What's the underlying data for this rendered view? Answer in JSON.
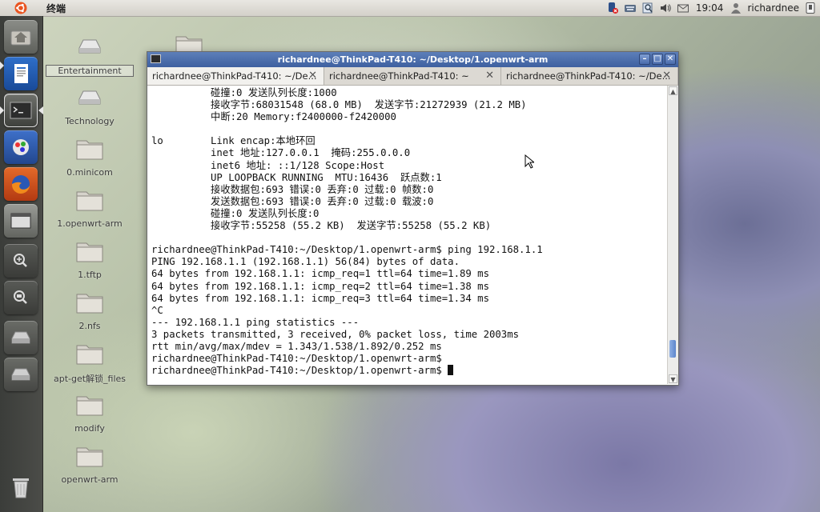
{
  "top_panel": {
    "app_title": "终端",
    "clock": "19:04",
    "username": "richardnee",
    "tray_icons": [
      "network-error-icon",
      "keyboard-icon",
      "search-icon",
      "volume-icon",
      "mail-icon"
    ]
  },
  "launcher": {
    "items": [
      {
        "name": "home-folder-icon"
      },
      {
        "name": "document-icon"
      },
      {
        "name": "terminal-icon"
      },
      {
        "name": "tweak-tool-icon"
      },
      {
        "name": "firefox-icon"
      },
      {
        "name": "window-icon"
      },
      {
        "name": "zoom-in-icon"
      },
      {
        "name": "zoom-icon"
      },
      {
        "name": "drive-icon"
      },
      {
        "name": "drive-icon"
      },
      {
        "name": "trash-icon"
      }
    ]
  },
  "desktop_icons": [
    {
      "label": "Entertainment",
      "type": "drive"
    },
    {
      "label": "Technology",
      "type": "drive"
    },
    {
      "label": "0.minicom",
      "type": "folder"
    },
    {
      "label": "1.openwrt-arm",
      "type": "folder"
    },
    {
      "label": "1.tftp",
      "type": "folder"
    },
    {
      "label": "2.nfs",
      "type": "folder"
    },
    {
      "label": "apt-get解锁_files",
      "type": "folder"
    },
    {
      "label": "modify",
      "type": "folder"
    },
    {
      "label": "openwrt-arm",
      "type": "folder"
    }
  ],
  "terminal": {
    "window_title": "richardnee@ThinkPad-T410: ~/Desktop/1.openwrt-arm",
    "tabs": [
      {
        "label": "richardnee@ThinkPad-T410: ~/De..."
      },
      {
        "label": "richardnee@ThinkPad-T410: ~"
      },
      {
        "label": "richardnee@ThinkPad-T410: ~/De..."
      }
    ],
    "lines": [
      "          碰撞:0 发送队列长度:1000",
      "          接收字节:68031548 (68.0 MB)  发送字节:21272939 (21.2 MB)",
      "          中断:20 Memory:f2400000-f2420000",
      "",
      "lo        Link encap:本地环回",
      "          inet 地址:127.0.0.1  掩码:255.0.0.0",
      "          inet6 地址: ::1/128 Scope:Host",
      "          UP LOOPBACK RUNNING  MTU:16436  跃点数:1",
      "          接收数据包:693 错误:0 丢弃:0 过载:0 帧数:0",
      "          发送数据包:693 错误:0 丢弃:0 过载:0 载波:0",
      "          碰撞:0 发送队列长度:0",
      "          接收字节:55258 (55.2 KB)  发送字节:55258 (55.2 KB)",
      "",
      "richardnee@ThinkPad-T410:~/Desktop/1.openwrt-arm$ ping 192.168.1.1",
      "PING 192.168.1.1 (192.168.1.1) 56(84) bytes of data.",
      "64 bytes from 192.168.1.1: icmp_req=1 ttl=64 time=1.89 ms",
      "64 bytes from 192.168.1.1: icmp_req=2 ttl=64 time=1.38 ms",
      "64 bytes from 192.168.1.1: icmp_req=3 ttl=64 time=1.34 ms",
      "^C",
      "--- 192.168.1.1 ping statistics ---",
      "3 packets transmitted, 3 received, 0% packet loss, time 2003ms",
      "rtt min/avg/max/mdev = 1.343/1.538/1.892/0.252 ms",
      "richardnee@ThinkPad-T410:~/Desktop/1.openwrt-arm$",
      "richardnee@ThinkPad-T410:~/Desktop/1.openwrt-arm$ "
    ]
  }
}
